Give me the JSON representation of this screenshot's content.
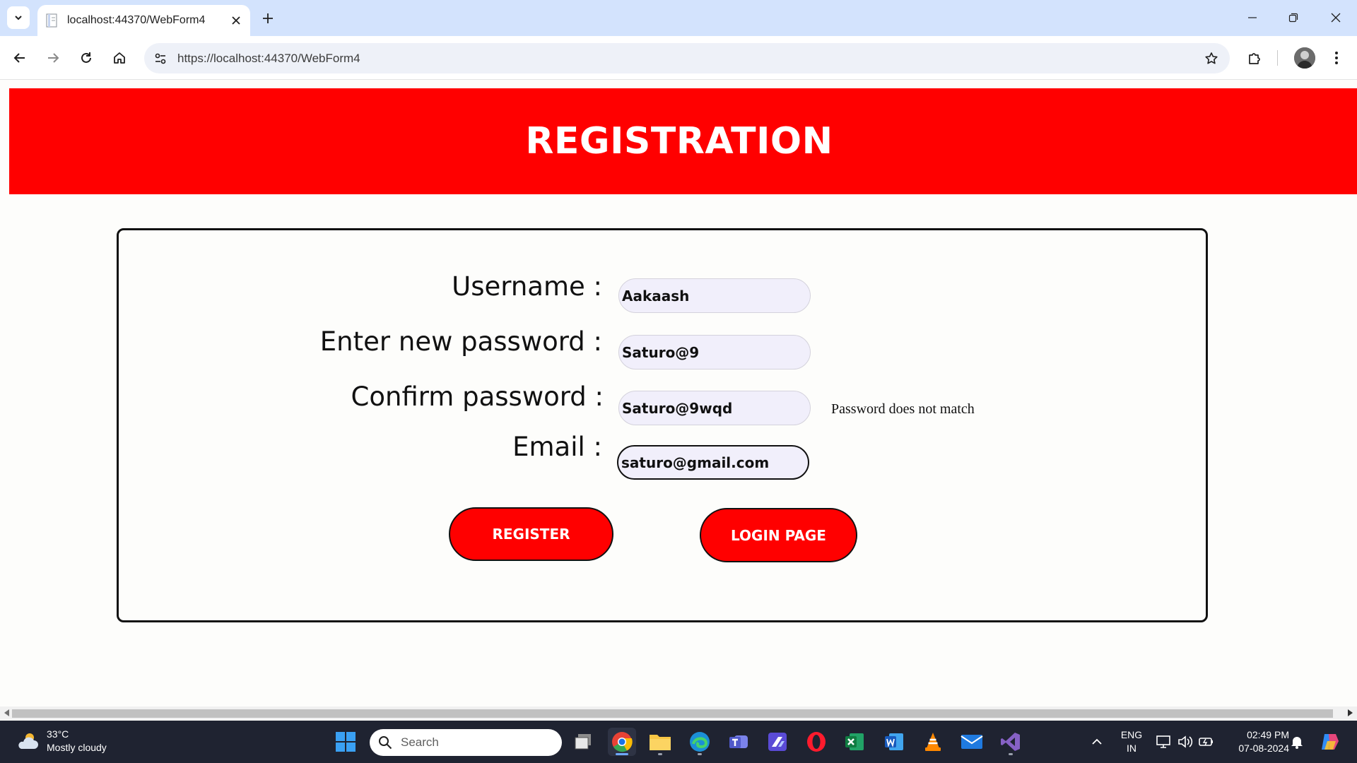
{
  "browser": {
    "tab_title": "localhost:44370/WebForm4",
    "url": "https://localhost:44370/WebForm4"
  },
  "page": {
    "banner_title": "REGISTRATION",
    "form": {
      "username_label": "Username :",
      "username_value": "Aakaash",
      "new_password_label": "Enter new password :",
      "new_password_value": "Saturo@9",
      "confirm_password_label": "Confirm password :",
      "confirm_password_value": "Saturo@9wqd",
      "password_error": "Password does not match",
      "email_label": "Email :",
      "email_value": "saturo@gmail.com",
      "register_button": "REGISTER",
      "login_button": "LOGIN PAGE"
    },
    "colors": {
      "banner": "#ff0000",
      "button": "#ff0000",
      "field_bg": "#f1effb"
    }
  },
  "taskbar": {
    "weather_temp": "33°C",
    "weather_desc": "Mostly cloudy",
    "search_placeholder": "Search",
    "lang_line1": "ENG",
    "lang_line2": "IN",
    "time": "02:49 PM",
    "date": "07-08-2024",
    "apps": [
      "start-icon",
      "task-view-icon",
      "chrome-icon",
      "file-explorer-icon",
      "edge-icon",
      "teams-icon",
      "powerautomate-icon",
      "opera-icon",
      "excel-icon",
      "word-icon",
      "vlc-icon",
      "mail-icon",
      "visual-studio-icon"
    ]
  }
}
